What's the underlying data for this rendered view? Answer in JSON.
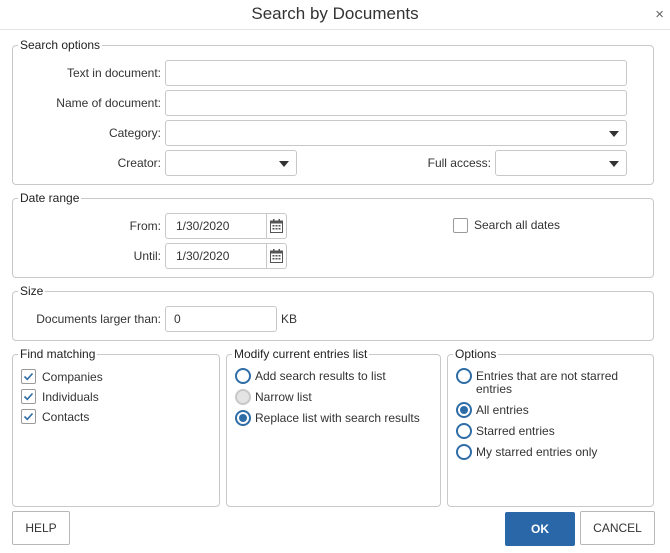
{
  "dialog": {
    "title": "Search by Documents",
    "close_glyph": "×"
  },
  "search_options": {
    "legend": "Search options",
    "text_in_document": {
      "label": "Text in document:",
      "value": ""
    },
    "name_of_document": {
      "label": "Name of document:",
      "value": ""
    },
    "category": {
      "label": "Category:",
      "value": ""
    },
    "creator": {
      "label": "Creator:",
      "value": ""
    },
    "full_access": {
      "label": "Full access:",
      "value": ""
    }
  },
  "date_range": {
    "legend": "Date range",
    "from": {
      "label": "From:",
      "value": "1/30/2020"
    },
    "until": {
      "label": "Until:",
      "value": "1/30/2020"
    },
    "search_all_dates": {
      "label": "Search all dates",
      "checked": false
    }
  },
  "size": {
    "legend": "Size",
    "larger_than": {
      "label": "Documents larger than:",
      "value": "0",
      "unit": "KB"
    }
  },
  "find_matching": {
    "legend": "Find matching",
    "items": [
      {
        "label": "Companies",
        "checked": true
      },
      {
        "label": "Individuals",
        "checked": true
      },
      {
        "label": "Contacts",
        "checked": true
      }
    ]
  },
  "modify_list": {
    "legend": "Modify current entries list",
    "items": [
      {
        "label": "Add search results to list",
        "state": "off"
      },
      {
        "label": "Narrow list",
        "state": "disabled"
      },
      {
        "label": "Replace list with search results",
        "state": "on"
      }
    ]
  },
  "options": {
    "legend": "Options",
    "items": [
      {
        "label": "Entries that are not starred entries",
        "state": "off"
      },
      {
        "label": "All entries",
        "state": "on"
      },
      {
        "label": "Starred entries",
        "state": "off"
      },
      {
        "label": "My starred entries only",
        "state": "off"
      }
    ]
  },
  "buttons": {
    "help": "HELP",
    "ok": "OK",
    "cancel": "CANCEL"
  },
  "colors": {
    "accent": "#2a67a8",
    "radio": "#2f6da7",
    "border": "#c8c8c8"
  },
  "icons": {
    "calendar": "calendar-icon",
    "dropdown": "chevron-down-icon",
    "check": "check-icon",
    "close": "close-icon"
  }
}
